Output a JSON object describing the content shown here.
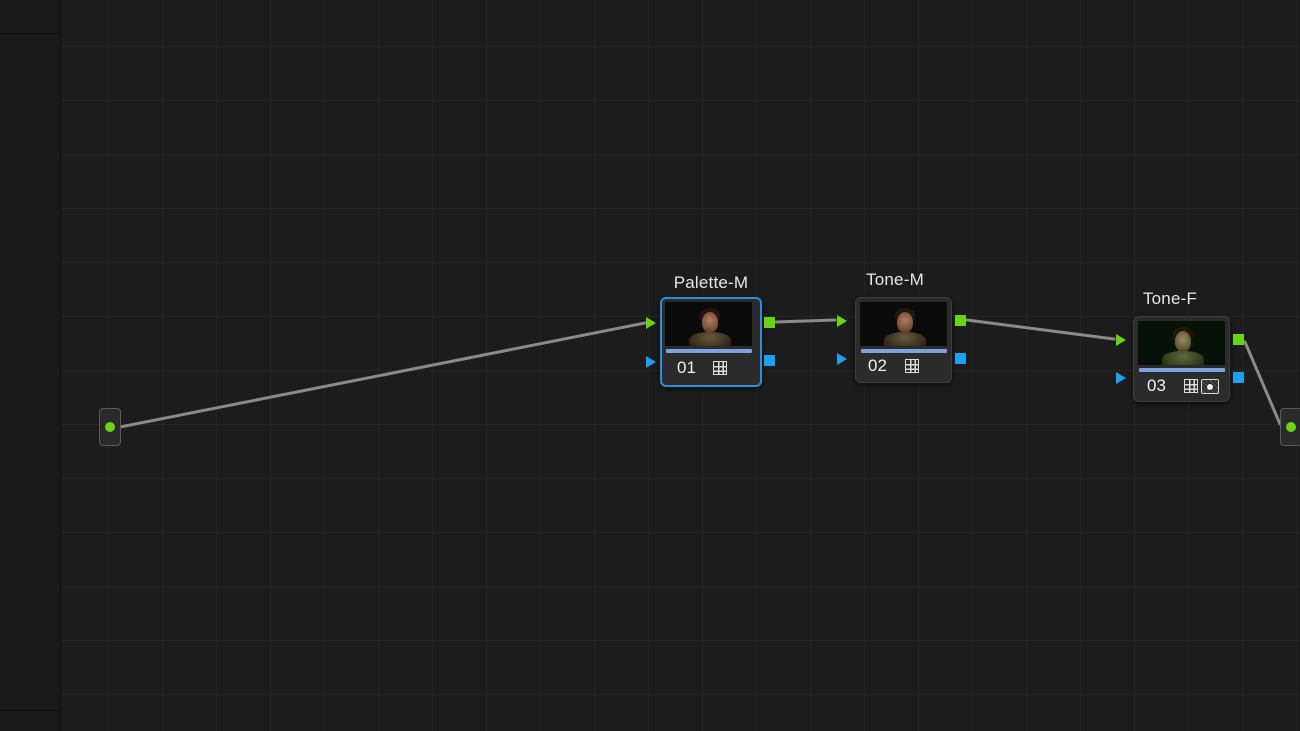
{
  "app": {
    "view": "node-editor"
  },
  "nodes": [
    {
      "id": "01",
      "label": "Palette-M",
      "number": "01",
      "selected": true,
      "icons": [
        "grid-icon"
      ]
    },
    {
      "id": "02",
      "label": "Tone-M",
      "number": "02",
      "selected": false,
      "icons": [
        "grid-icon"
      ]
    },
    {
      "id": "03",
      "label": "Tone-F",
      "number": "03",
      "selected": false,
      "icons": [
        "grid-icon",
        "camera-icon"
      ]
    }
  ],
  "connections": [
    {
      "from": "source-input",
      "to": "01"
    },
    {
      "from": "01",
      "to": "02"
    },
    {
      "from": "02",
      "to": "03"
    },
    {
      "from": "03",
      "to": "output"
    }
  ],
  "colors": {
    "rgb_port": "#6ad414",
    "alpha_port": "#1e9ff0",
    "selection": "#2d8ee0",
    "node_bar": "#7fa3de",
    "wire": "#8a8a8a"
  }
}
